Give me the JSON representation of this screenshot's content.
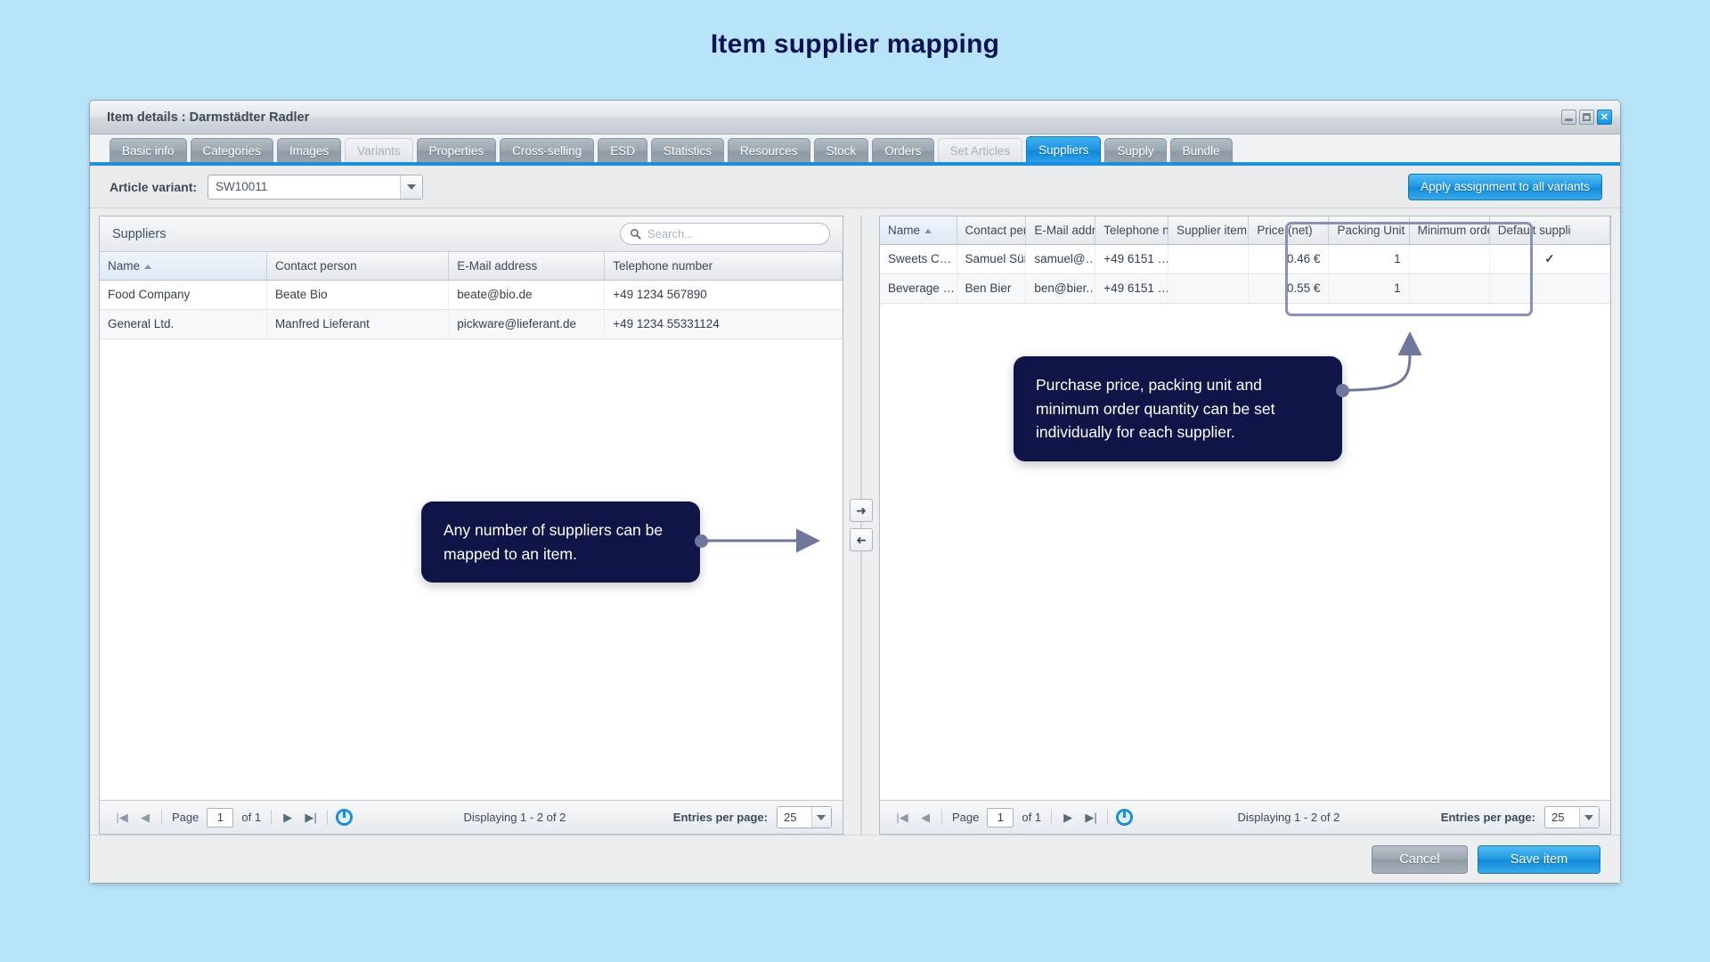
{
  "page": {
    "title": "Item supplier mapping"
  },
  "window": {
    "title": "Item details : Darmstädter Radler",
    "controls": {
      "minimize": "_",
      "maximize": "▢",
      "close": "✕"
    }
  },
  "tabs": [
    {
      "label": "Basic info",
      "state": "normal"
    },
    {
      "label": "Categories",
      "state": "normal"
    },
    {
      "label": "Images",
      "state": "normal"
    },
    {
      "label": "Variants",
      "state": "muted"
    },
    {
      "label": "Properties",
      "state": "normal"
    },
    {
      "label": "Cross-selling",
      "state": "normal"
    },
    {
      "label": "ESD",
      "state": "normal"
    },
    {
      "label": "Statistics",
      "state": "normal"
    },
    {
      "label": "Resources",
      "state": "normal"
    },
    {
      "label": "Stock",
      "state": "normal"
    },
    {
      "label": "Orders",
      "state": "normal"
    },
    {
      "label": "Set Articles",
      "state": "muted"
    },
    {
      "label": "Suppliers",
      "state": "active"
    },
    {
      "label": "Supply",
      "state": "normal"
    },
    {
      "label": "Bundle",
      "state": "normal"
    }
  ],
  "toolbar": {
    "variant_label": "Article variant:",
    "variant_value": "SW10011",
    "apply_label": "Apply assignment to all variants"
  },
  "left_panel": {
    "heading": "Suppliers",
    "search_placeholder": "Search...",
    "columns": [
      "Name",
      "Contact person",
      "E-Mail address",
      "Telephone number"
    ],
    "sorted_column": "Name",
    "sort_direction": "asc",
    "rows": [
      {
        "name": "Food Company",
        "contact": "Beate Bio",
        "email": "beate@bio.de",
        "phone": "+49 1234 567890"
      },
      {
        "name": "General Ltd.",
        "contact": "Manfred Lieferant",
        "email": "pickware@lieferant.de",
        "phone": "+49 1234 55331124"
      }
    ],
    "pager": {
      "page_label": "Page",
      "page_value": "1",
      "of_label": "of 1",
      "displaying": "Displaying 1 - 2 of 2",
      "entries_label": "Entries per page:",
      "entries_value": "25"
    }
  },
  "right_panel": {
    "columns": [
      "Name",
      "Contact persc",
      "E-Mail addres",
      "Telephone nu",
      "Supplier item",
      "Price (net)",
      "Packing Unit",
      "Minimum orde",
      "Default suppli"
    ],
    "sorted_column": "Name",
    "sort_direction": "asc",
    "rows": [
      {
        "name": "Sweets C…",
        "contact": "Samuel Süß",
        "email": "samuel@…",
        "phone": "+49 6151 …",
        "supplier_item": "",
        "price": "0.46 €",
        "packing_unit": "1",
        "minimum_order": "",
        "default": "✓"
      },
      {
        "name": "Beverage …",
        "contact": "Ben Bier",
        "email": "ben@bier.…",
        "phone": "+49 6151 …",
        "supplier_item": "",
        "price": "0.55 €",
        "packing_unit": "1",
        "minimum_order": "",
        "default": ""
      }
    ],
    "pager": {
      "page_label": "Page",
      "page_value": "1",
      "of_label": "of 1",
      "displaying": "Displaying 1 - 2 of 2",
      "entries_label": "Entries per page:",
      "entries_value": "25"
    }
  },
  "transfer": {
    "add": "➜",
    "remove": "➜"
  },
  "footer": {
    "cancel": "Cancel",
    "save": "Save item"
  },
  "callouts": {
    "suppliers": "Any number of suppliers can be mapped to an item.",
    "pricing": "Purchase price, packing unit and minimum order quantity can be set individually for each supplier."
  },
  "colors": {
    "page_background": "#b8e4fa",
    "title_text": "#0e1254",
    "accent_blue": "#1e96e2",
    "callout_bg": "#101548",
    "annotation": "#6f779d",
    "check_green": "#22b422"
  }
}
